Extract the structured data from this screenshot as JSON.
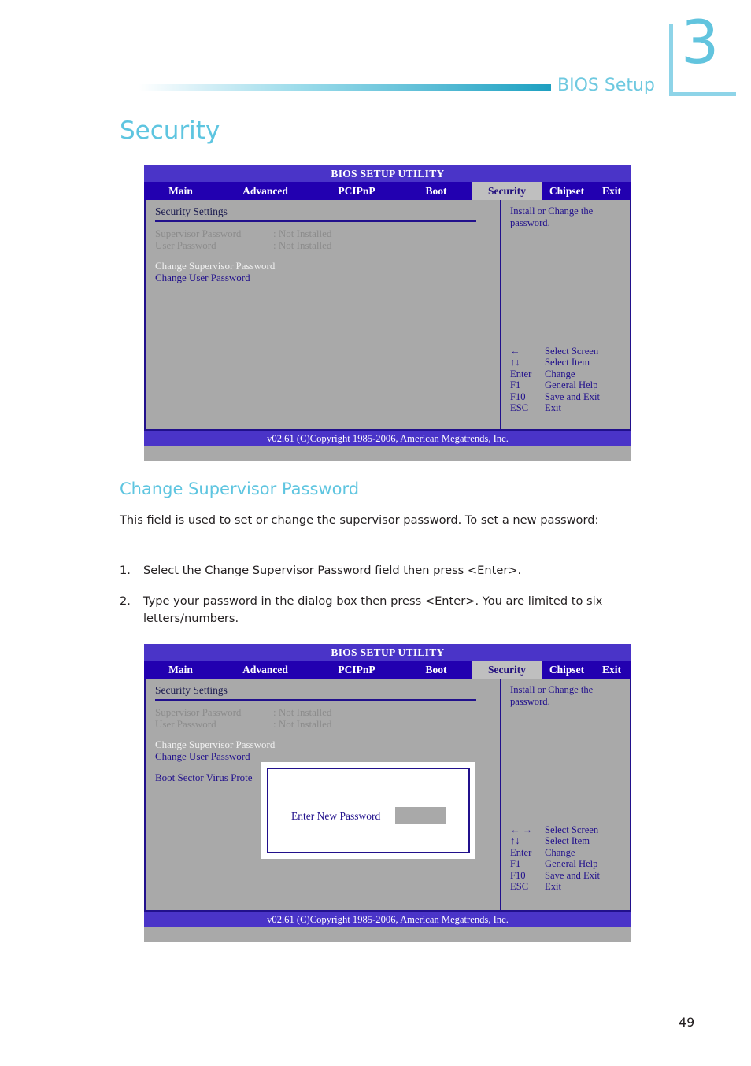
{
  "page": {
    "chapter_number": "3",
    "running_head": "BIOS Setup",
    "page_number": "49",
    "title": "Security",
    "subheading": "Change Supervisor Password",
    "intro_paragraph": "This field is used to set or change the supervisor password. To set a new password:",
    "steps": [
      {
        "marker": "1.",
        "text": "Select the Change Supervisor Password field then press <Enter>."
      },
      {
        "marker": "2.",
        "text": "Type your password in the dialog box then press <Enter>. You are limited to six letters/numbers."
      }
    ]
  },
  "colors": {
    "accent_cyan": "#5ec5e0",
    "chapter_mark": "#8ed4e8",
    "bios_title_bar": "#4a34c8",
    "bios_tab_bar": "#2200b0",
    "bios_panel": "#a9a9a9",
    "bios_border": "#21108c",
    "bios_text": "#21108c",
    "bios_dim_text": "#8c8c8c",
    "bios_light_text": "#efefef",
    "body_text": "#231f20"
  },
  "bios_screen_1": {
    "title": "BIOS SETUP UTILITY",
    "tabs": [
      {
        "label": "Main",
        "active": false
      },
      {
        "label": "Advanced",
        "active": false
      },
      {
        "label": "PCIPnP",
        "active": false
      },
      {
        "label": "Boot",
        "active": false
      },
      {
        "label": "Security",
        "active": true
      },
      {
        "label": "Chipset",
        "active": false
      },
      {
        "label": "Exit",
        "active": false
      }
    ],
    "section_title": "Security Settings",
    "status_rows": [
      {
        "label": "Supervisor Password",
        "value": ": Not Installed"
      },
      {
        "label": "User Password",
        "value": ": Not Installed"
      }
    ],
    "actions": [
      {
        "label": "Change Supervisor Password",
        "style": "light"
      },
      {
        "label": "Change User Password",
        "style": "normal"
      }
    ],
    "help_text": "Install or Change the password.",
    "key_legend": [
      {
        "key": "←",
        "desc": "Select Screen"
      },
      {
        "key": "↑↓",
        "desc": "Select Item"
      },
      {
        "key": "Enter",
        "desc": "Change"
      },
      {
        "key": "F1",
        "desc": "General Help"
      },
      {
        "key": "F10",
        "desc": "Save and Exit"
      },
      {
        "key": "ESC",
        "desc": "Exit"
      }
    ],
    "footer": "v02.61 (C)Copyright 1985-2006, American Megatrends, Inc."
  },
  "bios_screen_2": {
    "title": "BIOS SETUP UTILITY",
    "tabs": [
      {
        "label": "Main",
        "active": false
      },
      {
        "label": "Advanced",
        "active": false
      },
      {
        "label": "PCIPnP",
        "active": false
      },
      {
        "label": "Boot",
        "active": false
      },
      {
        "label": "Security",
        "active": true
      },
      {
        "label": "Chipset",
        "active": false
      },
      {
        "label": "Exit",
        "active": false
      }
    ],
    "section_title": "Security Settings",
    "status_rows": [
      {
        "label": "Supervisor Password",
        "value": ": Not Installed"
      },
      {
        "label": "User Password",
        "value": ": Not Installed"
      }
    ],
    "actions": [
      {
        "label": "Change Supervisor Password",
        "style": "light"
      },
      {
        "label": "Change User Password",
        "style": "normal"
      }
    ],
    "extra_item": "Boot Sector Virus Prote",
    "help_text": "Install or Change the password.",
    "key_legend": [
      {
        "key": "← →",
        "desc": "Select Screen"
      },
      {
        "key": "↑↓",
        "desc": "Select Item"
      },
      {
        "key": "Enter",
        "desc": "Change"
      },
      {
        "key": "F1",
        "desc": "General Help"
      },
      {
        "key": "F10",
        "desc": "Save and Exit"
      },
      {
        "key": "ESC",
        "desc": "Exit"
      }
    ],
    "dialog": {
      "label": "Enter New Password",
      "input_value": ""
    },
    "footer": "v02.61 (C)Copyright 1985-2006, American Megatrends, Inc."
  }
}
